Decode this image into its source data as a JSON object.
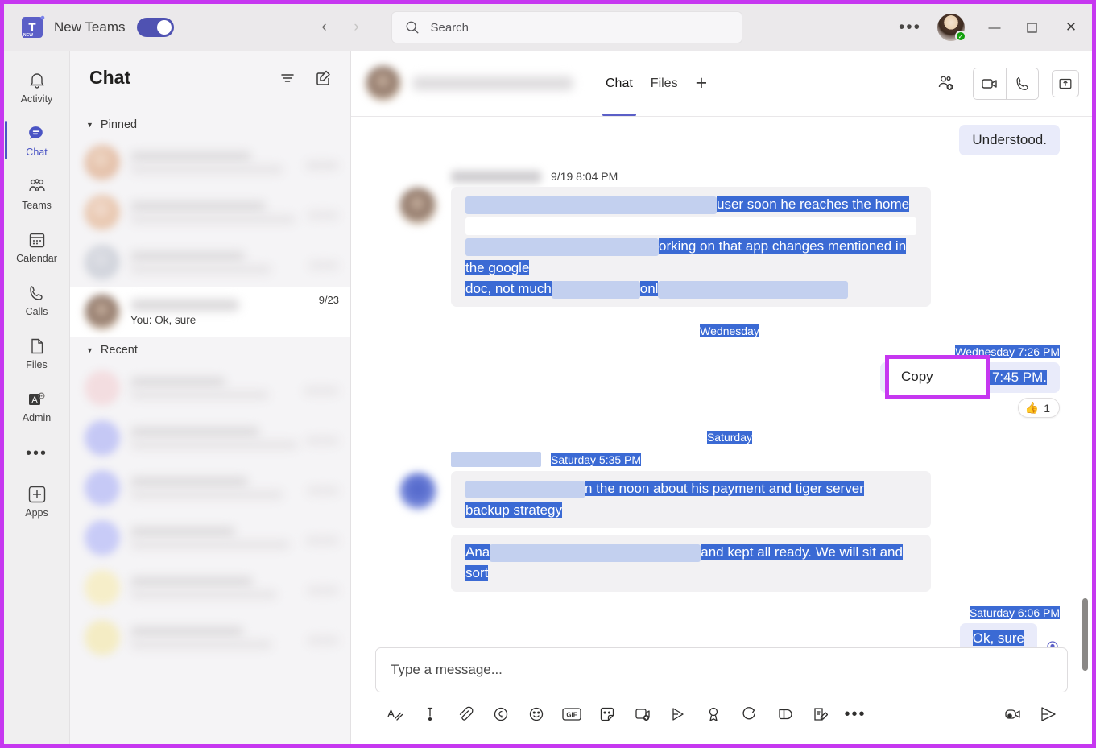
{
  "window": {
    "app_title": "New Teams",
    "toggle_state": "on",
    "logo_badge": "NEW",
    "logo_letter": "T",
    "nav_back": "‹",
    "nav_forward": "›",
    "more_options": "•••",
    "minimize": "—",
    "maximize": "☐",
    "close": "✕",
    "avatar_status": "available",
    "accent_color": "#5b5fc7",
    "annotation_color": "#c637f0"
  },
  "search": {
    "placeholder": "Search",
    "icon": "search-icon"
  },
  "rail": {
    "items": [
      {
        "label": "Activity",
        "icon": "bell-icon",
        "active": false
      },
      {
        "label": "Chat",
        "icon": "chat-bubble-icon",
        "active": true
      },
      {
        "label": "Teams",
        "icon": "people-icon",
        "active": false
      },
      {
        "label": "Calendar",
        "icon": "calendar-icon",
        "active": false
      },
      {
        "label": "Calls",
        "icon": "phone-icon",
        "active": false
      },
      {
        "label": "Files",
        "icon": "file-icon",
        "active": false
      },
      {
        "label": "Admin",
        "icon": "admin-gear-icon",
        "active": false
      }
    ],
    "more": "•••",
    "apps_label": "Apps"
  },
  "chat_list": {
    "title": "Chat",
    "filter_icon": "filter-icon",
    "compose_icon": "new-chat-icon",
    "groups": [
      {
        "label": "Pinned",
        "expanded": true
      },
      {
        "label": "Recent",
        "expanded": true
      }
    ],
    "selected_chat": {
      "name": "",
      "preview": "You: Ok, sure",
      "time": "9/23"
    }
  },
  "conversation": {
    "tabs": [
      {
        "label": "Chat",
        "active": true
      },
      {
        "label": "Files",
        "active": false
      }
    ],
    "add_tab": "+",
    "actions": [
      {
        "name": "add-people-icon"
      },
      {
        "name": "video-call-icon"
      },
      {
        "name": "audio-call-icon"
      },
      {
        "name": "popout-icon"
      }
    ],
    "messages": [
      {
        "id": "m1",
        "side": "out",
        "text": "Understood.",
        "selected": false
      },
      {
        "id": "m2",
        "side": "in",
        "sender_blurred": true,
        "timestamp": "9/19 8:04 PM",
        "timestamp_selected": false,
        "line1_visible": "user soon he reaches the home",
        "line2_visible": "orking on that app changes mentioned in the google",
        "line3_visible": "doc, not much",
        "line3_tail": "onl",
        "selected": true
      },
      {
        "id": "d1",
        "type": "day-divider",
        "label": "Wednesday",
        "selected": true
      },
      {
        "id": "m3",
        "side": "out",
        "timestamp": "Wednesday 7:26 PM",
        "timestamp_selected": true,
        "text": "Let's connect at 7:45 PM.",
        "selected": true,
        "reaction": {
          "emoji": "👍",
          "count": "1"
        }
      },
      {
        "id": "d2",
        "type": "day-divider",
        "label": "Saturday",
        "selected": true
      },
      {
        "id": "m4",
        "side": "in",
        "sender_blurred": true,
        "timestamp": "Saturday 5:35 PM",
        "timestamp_selected": true,
        "line1_visible": "n the noon about his payment and tiger server",
        "line2_visible": "backup strategy",
        "selected": true
      },
      {
        "id": "m5",
        "side": "in",
        "line1_prefix": "Ana",
        "line1_visible": "and kept all ready. We will sit and",
        "line2_visible": "sort",
        "selected": true
      },
      {
        "id": "m6",
        "side": "out",
        "timestamp": "Saturday 6:06 PM",
        "timestamp_selected": true,
        "text": "Ok, sure",
        "selected": true,
        "seen_icon": "seen-indicator-icon"
      }
    ]
  },
  "context_menu": {
    "items": [
      {
        "label": "Copy",
        "name": "copy-menu-item"
      }
    ]
  },
  "compose": {
    "placeholder": "Type a message...",
    "tools": [
      {
        "name": "format-icon"
      },
      {
        "name": "priority-icon"
      },
      {
        "name": "attach-icon"
      },
      {
        "name": "loop-icon"
      },
      {
        "name": "emoji-icon"
      },
      {
        "name": "gif-icon",
        "label": "GIF"
      },
      {
        "name": "sticker-icon"
      },
      {
        "name": "meet-now-icon"
      },
      {
        "name": "stream-icon"
      },
      {
        "name": "praise-icon"
      },
      {
        "name": "approvals-icon"
      },
      {
        "name": "apps-icon"
      },
      {
        "name": "notes-icon"
      },
      {
        "name": "more-options-icon",
        "label": "•••"
      }
    ],
    "right_tools": [
      {
        "name": "video-message-icon"
      },
      {
        "name": "send-icon"
      }
    ]
  },
  "colors": {
    "selection_blue": "#3b6ad4",
    "bubble_out": "#e9ebfa",
    "bubble_in": "#f2f1f3",
    "brand_purple": "#5b5fc7"
  }
}
